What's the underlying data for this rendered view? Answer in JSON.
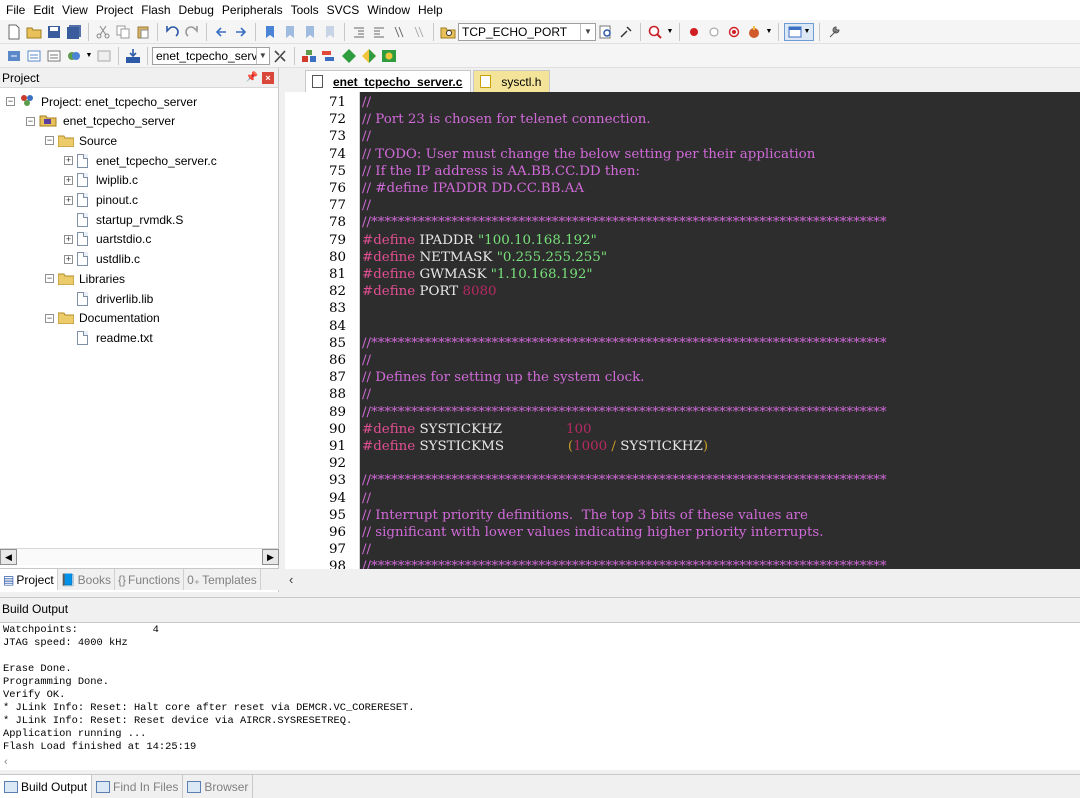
{
  "menu": [
    "File",
    "Edit",
    "View",
    "Project",
    "Flash",
    "Debug",
    "Peripherals",
    "Tools",
    "SVCS",
    "Window",
    "Help"
  ],
  "toolbar1": {
    "target_combo": "TCP_ECHO_PORT"
  },
  "toolbar2": {
    "project_combo": "enet_tcpecho_server"
  },
  "project_panel": {
    "title": "Project",
    "tree": [
      {
        "label": "Project: enet_tcpecho_server",
        "kind": "project",
        "expander": "−"
      },
      {
        "label": "enet_tcpecho_server",
        "kind": "target",
        "expander": "−"
      },
      {
        "label": "Source",
        "kind": "folder",
        "expander": "−"
      },
      {
        "label": "enet_tcpecho_server.c",
        "kind": "file",
        "expander": "+"
      },
      {
        "label": "lwiplib.c",
        "kind": "file",
        "expander": "+"
      },
      {
        "label": "pinout.c",
        "kind": "file",
        "expander": "+"
      },
      {
        "label": "startup_rvmdk.S",
        "kind": "file",
        "expander": ""
      },
      {
        "label": "uartstdio.c",
        "kind": "file",
        "expander": "+"
      },
      {
        "label": "ustdlib.c",
        "kind": "file",
        "expander": "+"
      },
      {
        "label": "Libraries",
        "kind": "folder",
        "expander": "−"
      },
      {
        "label": "driverlib.lib",
        "kind": "file",
        "expander": ""
      },
      {
        "label": "Documentation",
        "kind": "folder",
        "expander": "−"
      },
      {
        "label": "readme.txt",
        "kind": "file",
        "expander": ""
      }
    ],
    "tabs": [
      {
        "label": "Project",
        "icon": "project-icon"
      },
      {
        "label": "Books",
        "icon": "books-icon"
      },
      {
        "label": "Functions",
        "icon": "functions-icon"
      },
      {
        "label": "Templates",
        "icon": "templates-icon"
      }
    ]
  },
  "editor": {
    "tabs": [
      {
        "label": "enet_tcpecho_server.c",
        "active": true
      },
      {
        "label": "sysctl.h",
        "active": false
      }
    ],
    "lines": [
      {
        "no": "71",
        "tokens": [
          {
            "t": "//",
            "c": "comment"
          }
        ]
      },
      {
        "no": "72",
        "tokens": [
          {
            "t": "// Port 23 is chosen for telenet connection.",
            "c": "comment"
          }
        ]
      },
      {
        "no": "73",
        "tokens": [
          {
            "t": "//",
            "c": "comment"
          }
        ]
      },
      {
        "no": "74",
        "tokens": [
          {
            "t": "// TODO: User must change the below setting per their application",
            "c": "comment"
          }
        ]
      },
      {
        "no": "75",
        "tokens": [
          {
            "t": "// If the IP address is AA.BB.CC.DD then:",
            "c": "comment"
          }
        ]
      },
      {
        "no": "76",
        "tokens": [
          {
            "t": "// #define IPADDR DD.CC.BB.AA",
            "c": "comment"
          }
        ]
      },
      {
        "no": "77",
        "tokens": [
          {
            "t": "//",
            "c": "comment"
          }
        ]
      },
      {
        "no": "78",
        "tokens": [
          {
            "t": "//*****************************************************************************",
            "c": "comment"
          }
        ]
      },
      {
        "no": "79",
        "tokens": [
          {
            "t": "#define",
            "c": "kw"
          },
          {
            "t": " IPADDR ",
            "c": "id"
          },
          {
            "t": "\"100.10.168.192\"",
            "c": "str"
          }
        ]
      },
      {
        "no": "80",
        "tokens": [
          {
            "t": "#define",
            "c": "kw"
          },
          {
            "t": " NETMASK ",
            "c": "id"
          },
          {
            "t": "\"0.255.255.255\"",
            "c": "str"
          }
        ]
      },
      {
        "no": "81",
        "tokens": [
          {
            "t": "#define",
            "c": "kw"
          },
          {
            "t": " GWMASK ",
            "c": "id"
          },
          {
            "t": "\"1.10.168.192\"",
            "c": "str"
          }
        ]
      },
      {
        "no": "82",
        "tokens": [
          {
            "t": "#define",
            "c": "kw"
          },
          {
            "t": " PORT ",
            "c": "id"
          },
          {
            "t": "8080",
            "c": "num"
          }
        ]
      },
      {
        "no": "83",
        "tokens": []
      },
      {
        "no": "84",
        "tokens": []
      },
      {
        "no": "85",
        "tokens": [
          {
            "t": "//*****************************************************************************",
            "c": "comment"
          }
        ]
      },
      {
        "no": "86",
        "tokens": [
          {
            "t": "//",
            "c": "comment"
          }
        ]
      },
      {
        "no": "87",
        "tokens": [
          {
            "t": "// Defines for setting up the system clock.",
            "c": "comment"
          }
        ]
      },
      {
        "no": "88",
        "tokens": [
          {
            "t": "//",
            "c": "comment"
          }
        ]
      },
      {
        "no": "89",
        "tokens": [
          {
            "t": "//*****************************************************************************",
            "c": "comment"
          }
        ]
      },
      {
        "no": "90",
        "tokens": [
          {
            "t": "#define",
            "c": "kw"
          },
          {
            "t": " SYSTICKHZ               ",
            "c": "id"
          },
          {
            "t": "100",
            "c": "num"
          }
        ]
      },
      {
        "no": "91",
        "tokens": [
          {
            "t": "#define",
            "c": "kw"
          },
          {
            "t": " SYSTICKMS               ",
            "c": "id"
          },
          {
            "t": "(",
            "c": "op"
          },
          {
            "t": "1000",
            "c": "num"
          },
          {
            "t": " / ",
            "c": "op"
          },
          {
            "t": "SYSTICKHZ",
            "c": "id"
          },
          {
            "t": ")",
            "c": "op"
          }
        ]
      },
      {
        "no": "92",
        "tokens": []
      },
      {
        "no": "93",
        "tokens": [
          {
            "t": "//*****************************************************************************",
            "c": "comment"
          }
        ]
      },
      {
        "no": "94",
        "tokens": [
          {
            "t": "//",
            "c": "comment"
          }
        ]
      },
      {
        "no": "95",
        "tokens": [
          {
            "t": "// Interrupt priority definitions.  The top 3 bits of these values are",
            "c": "comment"
          }
        ]
      },
      {
        "no": "96",
        "tokens": [
          {
            "t": "// significant with lower values indicating higher priority interrupts.",
            "c": "comment"
          }
        ]
      },
      {
        "no": "97",
        "tokens": [
          {
            "t": "//",
            "c": "comment"
          }
        ]
      },
      {
        "no": "98",
        "tokens": [
          {
            "t": "//*****************************************************************************",
            "c": "comment"
          }
        ]
      }
    ]
  },
  "build_output": {
    "title": "Build Output",
    "lines": [
      "Watchpoints:            4",
      "JTAG speed: 4000 kHz",
      "",
      "Erase Done.",
      "Programming Done.",
      "Verify OK.",
      "* JLink Info: Reset: Halt core after reset via DEMCR.VC_CORERESET.",
      "* JLink Info: Reset: Reset device via AIRCR.SYSRESETREQ.",
      "Application running ...",
      "Flash Load finished at 14:25:19"
    ],
    "tabs": [
      {
        "label": "Build Output",
        "active": true
      },
      {
        "label": "Find In Files",
        "active": false
      },
      {
        "label": "Browser",
        "active": false
      }
    ]
  },
  "colors": {
    "code_bg": "#2d2d2d",
    "comment": "#d06ad8",
    "keyword": "#e24f93",
    "string": "#78e07a",
    "number": "#b52a62"
  }
}
